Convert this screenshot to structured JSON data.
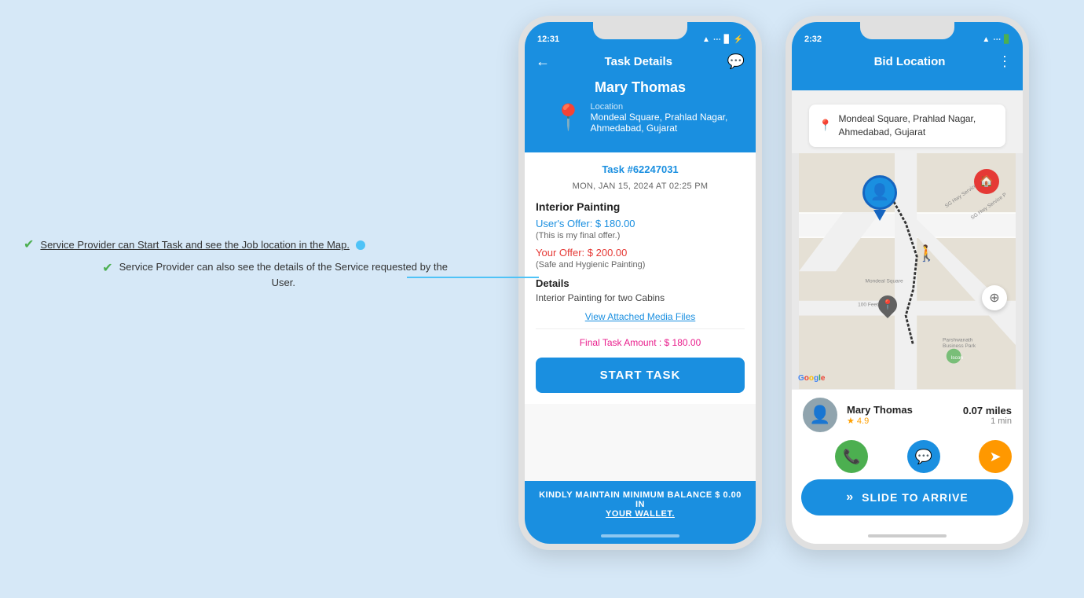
{
  "background_color": "#d6e8f7",
  "annotation": {
    "line1": "Service Provider can Start Task and see the Job location in the Map.",
    "line2_part1": "Service Provider can also see the details of the Service requested by the",
    "line2_part2": "User."
  },
  "phone1": {
    "status_bar": {
      "time": "12:31",
      "icons": "▲ ))) ⚡"
    },
    "header": {
      "title": "Task Details",
      "back": "←",
      "chat_icon": "💬"
    },
    "user": {
      "name": "Mary Thomas",
      "location_label": "Location",
      "address_line1": "Mondeal Square, Prahlad Nagar,",
      "address_line2": "Ahmedabad, Gujarat"
    },
    "task": {
      "number": "Task #62247031",
      "date": "MON, JAN 15, 2024 AT 02:25 PM",
      "service_title": "Interior Painting",
      "user_offer_label": "User's Offer: $ 180.00",
      "user_offer_note": "(This is my final offer.)",
      "your_offer_label": "Your Offer: $ 200.00",
      "your_offer_note": "(Safe and Hygienic Painting)",
      "details_heading": "Details",
      "details_text": "Interior Painting for two Cabins",
      "media_link": "View Attached Media Files",
      "final_amount": "Final Task Amount : $ 180.00",
      "start_button": "START TASK"
    },
    "wallet": {
      "text": "KINDLY MAINTAIN MINIMUM BALANCE $ 0.00 IN YOUR WALLET."
    }
  },
  "phone2": {
    "status_bar": {
      "time": "2:32",
      "icons": "▲ ))) 🔋"
    },
    "header": {
      "title": "Bid Location",
      "menu": "⋮"
    },
    "location_search": {
      "address_line1": "Mondeal Square, Prahlad Nagar,",
      "address_line2": "Ahmedabad, Gujarat"
    },
    "provider": {
      "name": "Mary Thomas",
      "rating": "★ 4.9",
      "distance": "0.07 miles",
      "time": "1 min"
    },
    "slide_button": "SLIDE TO ARRIVE",
    "slide_arrows": "»"
  }
}
